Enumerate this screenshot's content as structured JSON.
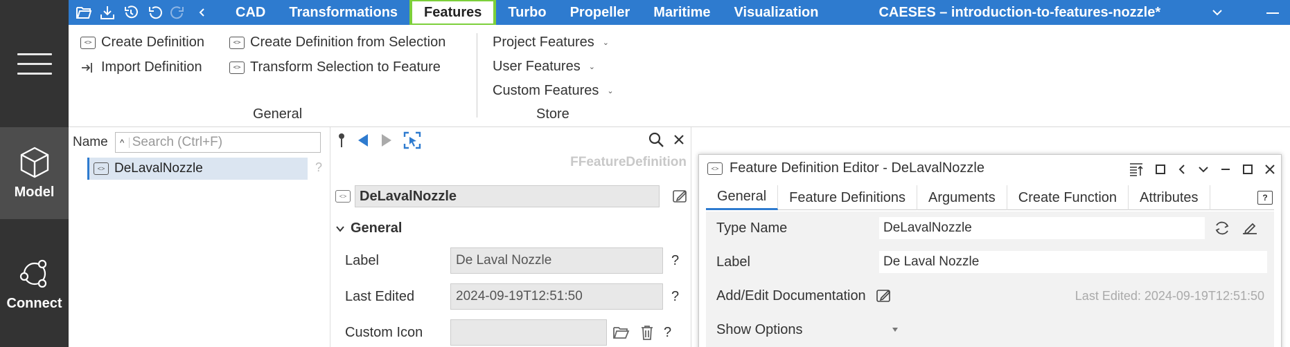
{
  "quick_access": {
    "icons": [
      "open-folder-icon",
      "save-icon",
      "history-icon",
      "undo-icon",
      "redo-icon",
      "chevron-left-icon"
    ]
  },
  "menu": {
    "tabs": [
      {
        "label": "CAD"
      },
      {
        "label": "Transformations"
      },
      {
        "label": "Features"
      },
      {
        "label": "Turbo"
      },
      {
        "label": "Propeller"
      },
      {
        "label": "Maritime"
      },
      {
        "label": "Visualization"
      }
    ],
    "active_tab": "Features",
    "app_title": "CAESES – introduction-to-features-nozzle*"
  },
  "ribbon": {
    "general": {
      "create_definition": "Create Definition",
      "create_from_selection": "Create Definition from Selection",
      "import_definition": "Import Definition",
      "transform_selection": "Transform Selection to Feature",
      "group_label": "General"
    },
    "store": {
      "project_features": "Project Features",
      "user_features": "User Features",
      "custom_features": "Custom Features",
      "group_label": "Store"
    }
  },
  "rail": {
    "model_label": "Model",
    "connect_label": "Connect"
  },
  "tree": {
    "name_label": "Name",
    "search_placeholder": "Search (Ctrl+F)",
    "items": [
      {
        "label": "DeLavalNozzle"
      }
    ],
    "help": "?"
  },
  "properties": {
    "type_label": "FFeatureDefinition",
    "object_name": "DeLavalNozzle",
    "section_title": "General",
    "rows": [
      {
        "label": "Label",
        "value": "De Laval Nozzle"
      },
      {
        "label": "Last Edited",
        "value": "2024-09-19T12:51:50"
      },
      {
        "label": "Custom Icon",
        "value": ""
      }
    ],
    "help": "?"
  },
  "dialog": {
    "title": "Feature Definition Editor - DeLavalNozzle",
    "tabs": [
      "General",
      "Feature Definitions",
      "Arguments",
      "Create Function",
      "Attributes"
    ],
    "active_tab": "General",
    "help": "?",
    "type_name_label": "Type Name",
    "type_name_value": "DeLavalNozzle",
    "label_label": "Label",
    "label_value": "De Laval Nozzle",
    "doc_label": "Add/Edit Documentation",
    "last_edited": "Last Edited: 2024-09-19T12:51:50",
    "show_options_label": "Show Options"
  },
  "colors": {
    "menubar": "#2e7bcf",
    "active_tab_border": "#7ccf3b",
    "rail": "#333333",
    "rail_active": "#4d4d4d",
    "selection": "#dbe5f1"
  }
}
